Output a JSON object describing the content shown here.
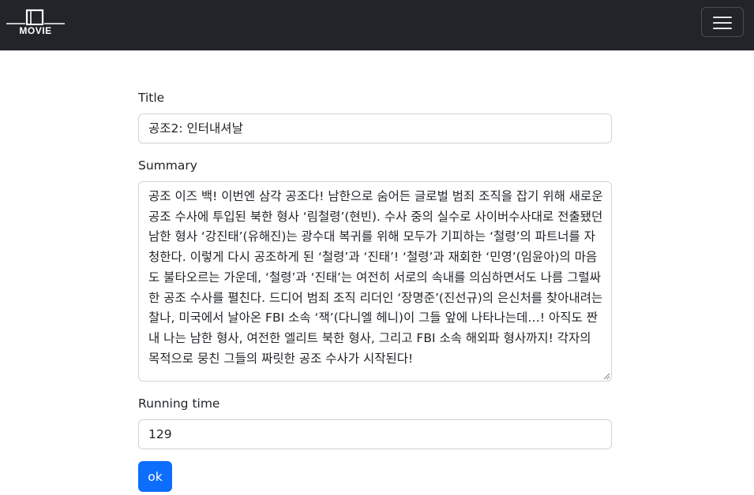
{
  "navbar": {
    "brand_text": "MOVIE",
    "toggler_icon": "hamburger-menu-icon"
  },
  "form": {
    "title_label": "Title",
    "title_value": "공조2: 인터내셔날",
    "summary_label": "Summary",
    "summary_value": "공조 이즈 백! 이번엔 삼각 공조다! 남한으로 숨어든 글로벌 범죄 조직을 잡기 위해 새로운 공조 수사에 투입된 북한 형사 ‘림철령’(현빈). 수사 중의 실수로 사이버수사대로 전출됐던 남한 형사 ‘강진태’(유해진)는 광수대 복귀를 위해 모두가 기피하는 ‘철령’의 파트너를 자청한다. 이렇게 다시 공조하게 된 ‘철령’과 ‘진태’! ‘철령’과 재회한 ‘민영’(임윤아)의 마음도 불타오르는 가운데, ‘철령’과 ‘진태’는 여전히 서로의 속내를 의심하면서도 나름 그럴싸한 공조 수사를 펼친다. 드디어 범죄 조직 리더인 ‘장명준’(진선규)의 은신처를 찾아내려는 찰나, 미국에서 날아온 FBI 소속 ‘잭’(다니엘 헤니)이 그들 앞에 나타나는데…! 아직도 짠내 나는 남한 형사, 여전한 엘리트 북한 형사, 그리고 FBI 소속 해외파 형사까지! 각자의 목적으로 뭉친 그들의 짜릿한 공조 수사가 시작된다!",
    "running_label": "Running time",
    "running_value": "129",
    "ok_label": "ok"
  },
  "colors": {
    "navbar_bg": "#212529",
    "primary_button": "#0d6efd",
    "input_border": "#ced4da"
  }
}
